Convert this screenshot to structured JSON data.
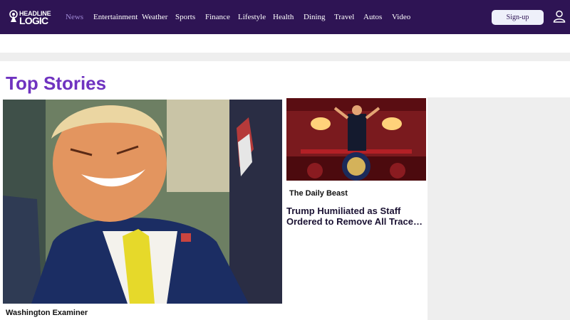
{
  "header": {
    "logo_top": "HEADLINE",
    "logo_bottom": "LOGIC",
    "nav": [
      "News",
      "Entertainment",
      "Weather",
      "Sports",
      "Finance",
      "Lifestyle",
      "Health",
      "Dining",
      "Travel",
      "Autos",
      "Video"
    ],
    "active_nav": "News",
    "signup_label": "Sign-up",
    "colors": {
      "bar": "#2e1454",
      "active": "#a08ad6",
      "title": "#6f33c0"
    }
  },
  "main": {
    "section_title": "Top Stories",
    "hero": {
      "source": "Washington Examiner",
      "image": "photo-man-laughing"
    },
    "card": {
      "source": "The Daily Beast",
      "headline": "Trump Humiliated as Staff Ordered to Remove All Trace…",
      "image": "photo-man-at-podium"
    }
  },
  "icons": {
    "user": "user-icon",
    "logo_mark": "antenna-icon"
  }
}
